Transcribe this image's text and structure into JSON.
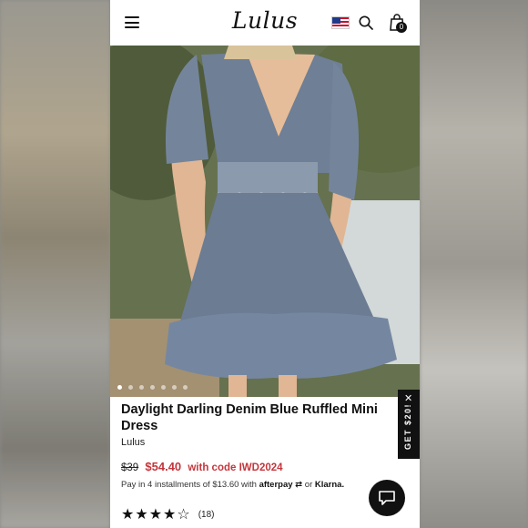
{
  "header": {
    "logo_text": "Lulus",
    "cart_count": "0"
  },
  "product": {
    "title": "Daylight Darling Denim Blue Ruffled Mini Dress",
    "brand": "Lulus",
    "original_price": "$39",
    "sale_price": "$54.40",
    "promo_text": "with code IWD2024",
    "installments_prefix": "Pay in 4 installments of $13.60 with",
    "afterpay_label": "afterpay",
    "or_text": "or",
    "klarna_label": "Klarna.",
    "rating_stars": "★★★★☆",
    "rating_value": 4.5,
    "review_count": "(18)"
  },
  "carousel": {
    "dot_count": 7,
    "active_index": 0
  },
  "promo_tab": {
    "label": "GET $20!",
    "close": "✕"
  },
  "colors": {
    "sale_red": "#c4363b",
    "dark": "#111111"
  }
}
